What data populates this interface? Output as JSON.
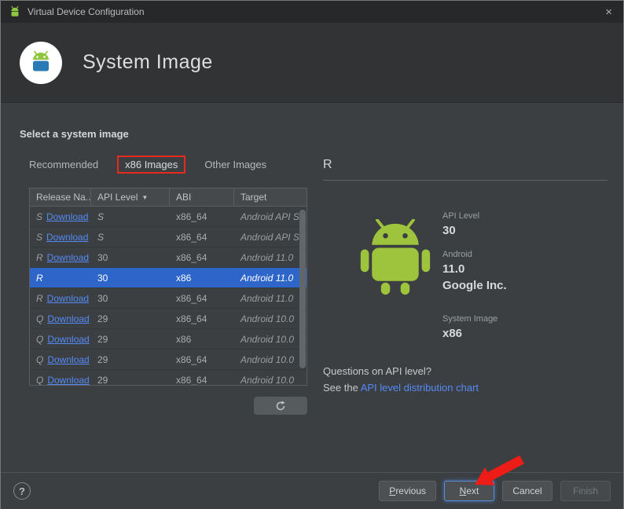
{
  "colors": {
    "annotation_red": "#e8291c",
    "selection_blue": "#2e65c9",
    "link_blue": "#548af7",
    "android_green": "#9ec43d"
  },
  "window": {
    "title": "Virtual Device Configuration",
    "close": "×"
  },
  "header": {
    "title": "System Image"
  },
  "content": {
    "section_title": "Select a system image",
    "tabs": [
      {
        "label": "Recommended",
        "selected": false,
        "annotated": false
      },
      {
        "label": "x86 Images",
        "selected": true,
        "annotated": true
      },
      {
        "label": "Other Images",
        "selected": false,
        "annotated": false
      }
    ],
    "table": {
      "columns": [
        {
          "label": "Release Na...",
          "sort": false
        },
        {
          "label": "API Level",
          "sort": true
        },
        {
          "label": "ABI",
          "sort": false
        },
        {
          "label": "Target",
          "sort": false
        }
      ],
      "rows": [
        {
          "release": "S",
          "download": "Download",
          "api": "S",
          "abi": "x86_64",
          "target": "Android API S",
          "selected": false
        },
        {
          "release": "S",
          "download": "Download",
          "api": "S",
          "abi": "x86_64",
          "target": "Android API S",
          "selected": false
        },
        {
          "release": "R",
          "download": "Download",
          "api": "30",
          "abi": "x86_64",
          "target": "Android 11.0",
          "selected": false
        },
        {
          "release": "R",
          "download": "",
          "api": "30",
          "abi": "x86",
          "target": "Android 11.0",
          "selected": true
        },
        {
          "release": "R",
          "download": "Download",
          "api": "30",
          "abi": "x86_64",
          "target": "Android 11.0",
          "selected": false
        },
        {
          "release": "Q",
          "download": "Download",
          "api": "29",
          "abi": "x86_64",
          "target": "Android 10.0",
          "selected": false
        },
        {
          "release": "Q",
          "download": "Download",
          "api": "29",
          "abi": "x86",
          "target": "Android 10.0",
          "selected": false
        },
        {
          "release": "Q",
          "download": "Download",
          "api": "29",
          "abi": "x86_64",
          "target": "Android 10.0",
          "selected": false
        },
        {
          "release": "Q",
          "download": "Download",
          "api": "29",
          "abi": "x86_64",
          "target": "Android 10.0",
          "selected": false
        }
      ]
    }
  },
  "details": {
    "title": "R",
    "api_level_label": "API Level",
    "api_level_value": "30",
    "android_label": "Android",
    "android_version": "11.0",
    "vendor": "Google Inc.",
    "system_image_label": "System Image",
    "system_image_value": "x86",
    "question": "Questions on API level?",
    "see_the": "See the ",
    "link_label": "API level distribution chart"
  },
  "footer": {
    "help": "?",
    "previous": "Previous",
    "next": "Next",
    "cancel": "Cancel",
    "finish": "Finish"
  }
}
